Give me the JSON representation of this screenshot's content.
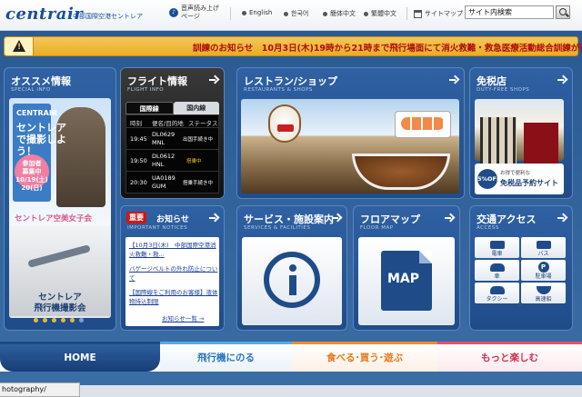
{
  "header": {
    "logo": "centrair",
    "logo_sub": "中部国際空港セントレア",
    "links": {
      "voice": "音声読み上げ\nページ",
      "english": "English",
      "korean": "한국어",
      "simplified": "簡体中文",
      "traditional": "繁體中文",
      "sitemap": "サイトマップ"
    },
    "search_value": "サイト内検索"
  },
  "alert": {
    "text": "訓練のお知らせ　10月3日(木)19時から21時まで飛行場面にて消火救難・救急医療活動総合訓練が行わ"
  },
  "special": {
    "title": "オススメ情報",
    "sub": "SPECIAL INFO",
    "card_brand": "CENTRAIR",
    "card_headline": "セントレアで撮影しよう！",
    "card_badge": "参加者\n募集中\n10/19(土)\n20(日)",
    "card_caption": "セントレア空美女子会",
    "card_bottom": "セントレア\n飛行機撮影会",
    "slides": 6
  },
  "flight": {
    "title": "フライト情報",
    "sub": "FLIGHT INFO",
    "tab_intl": "国際線",
    "tab_dom": "国内線",
    "headers": {
      "time": "時刻",
      "flight": "便名/目的地",
      "status": "ステータス"
    },
    "rows": [
      {
        "time": "19:45",
        "flight": "DL0629",
        "dest": "MNL",
        "status": "出国手続き中"
      },
      {
        "time": "19:50",
        "flight": "DL0612",
        "dest": "HNL",
        "status": "搭乗中"
      },
      {
        "time": "20:30",
        "flight": "UA0189",
        "dest": "GUM",
        "status": "搭乗手続き中"
      }
    ]
  },
  "restaurants": {
    "title": "レストラン/ショップ",
    "sub": "RESTAURANTS & SHOPS"
  },
  "dutyfree": {
    "title": "免税店",
    "sub": "DUTY-FREE SHOPS",
    "badge": "5%OFF",
    "promo_small": "お得で便利な",
    "promo_big": "免税品予約サイト"
  },
  "notices": {
    "tag": "重要",
    "title": "お知らせ",
    "sub": "IMPORTANT NOTICES",
    "items": [
      "【10月3日(木)　中部国際空港消火救難・救...",
      "バゲージベルトの外れ防止について",
      "【国際線をご利用のお客様】液体物持込制限"
    ],
    "more": "お知らせ一覧 →"
  },
  "services": {
    "title": "サービス・施設案内",
    "sub": "SERVICES & FACILITIES"
  },
  "floormap": {
    "title": "フロアマップ",
    "sub": "FLOOR MAP",
    "map_label": "MAP"
  },
  "access": {
    "title": "交通アクセス",
    "sub": "ACCESS",
    "items": {
      "train": "電車",
      "bus": "バス",
      "car": "車",
      "parking": "駐車場",
      "taxi": "タクシー",
      "ferry": "高速船"
    }
  },
  "nav": {
    "home": "HOME",
    "fly": "飛行機にのる",
    "eat": "食べる･買う･遊ぶ",
    "fun": "もっと楽しむ"
  },
  "status_bar": "hotography/"
}
